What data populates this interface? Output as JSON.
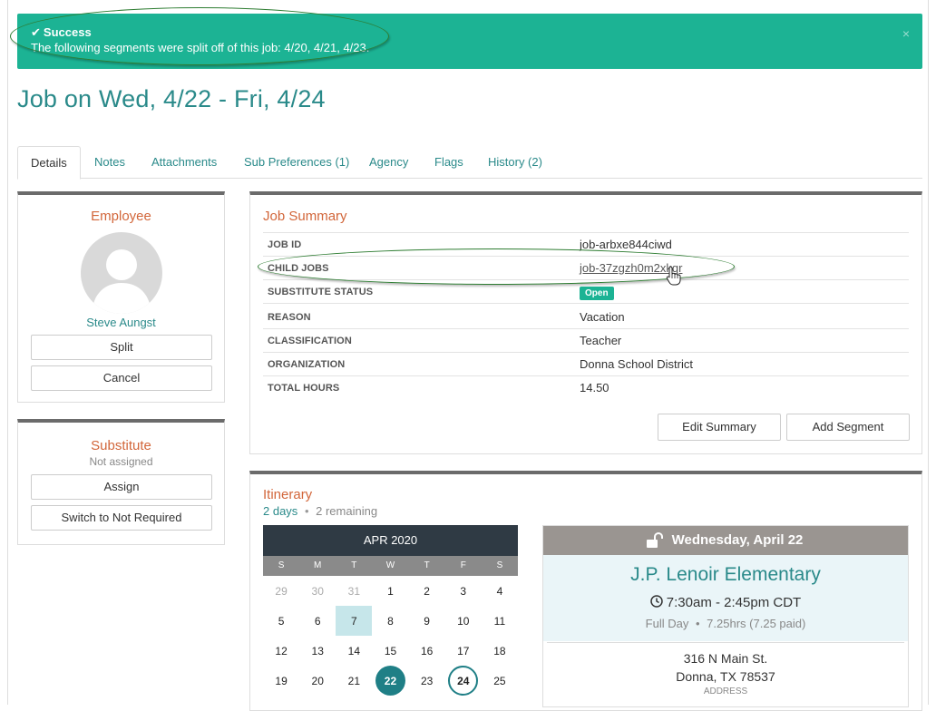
{
  "alert": {
    "title": "Success",
    "message": "The following segments were split off of this job: 4/20, 4/21, 4/23.",
    "close": "×",
    "color": "#1cb394"
  },
  "page": {
    "title": "Job on Wed, 4/22 - Fri, 4/24"
  },
  "tabs": [
    {
      "label": "Details"
    },
    {
      "label": "Notes"
    },
    {
      "label": "Attachments"
    },
    {
      "label": "Sub Preferences (1)"
    },
    {
      "label": "Agency"
    },
    {
      "label": "Flags"
    },
    {
      "label": "History (2)"
    }
  ],
  "employee": {
    "heading": "Employee",
    "name": "Steve Aungst",
    "split_label": "Split",
    "cancel_label": "Cancel"
  },
  "substitute": {
    "heading": "Substitute",
    "status": "Not assigned",
    "assign_label": "Assign",
    "switch_label": "Switch to Not Required"
  },
  "job_summary": {
    "heading": "Job Summary",
    "job_id_key": "JOB ID",
    "job_id": "job-arbxe844ciwd",
    "child_jobs_key": "CHILD JOBS",
    "child_jobs": "job-37zgzh0m2xkqr",
    "sub_status_key": "SUBSTITUTE STATUS",
    "sub_status": "Open",
    "reason_key": "REASON",
    "reason": "Vacation",
    "classification_key": "CLASSIFICATION",
    "classification": "Teacher",
    "organization_key": "ORGANIZATION",
    "organization": "Donna School District",
    "total_hours_key": "TOTAL HOURS",
    "total_hours": "14.50",
    "edit_label": "Edit Summary",
    "add_segment_label": "Add Segment"
  },
  "itinerary": {
    "heading": "Itinerary",
    "days": "2 days",
    "remaining": "2 remaining",
    "calendar": {
      "month": "APR 2020",
      "dow": [
        "S",
        "M",
        "T",
        "W",
        "T",
        "F",
        "S"
      ],
      "week1": [
        "29",
        "30",
        "31",
        "1",
        "2",
        "3",
        "4"
      ],
      "week2": [
        "5",
        "6",
        "7",
        "8",
        "9",
        "10",
        "11"
      ],
      "week3": [
        "12",
        "13",
        "14",
        "15",
        "16",
        "17",
        "18"
      ],
      "week4": [
        "19",
        "20",
        "21",
        "22",
        "23",
        "24",
        "25"
      ]
    },
    "day_card": {
      "date": "Wednesday, April 22",
      "school": "J.P. Lenoir Elementary",
      "time": "7:30am - 2:45pm CDT",
      "type": "Full Day",
      "hours": "7.25hrs",
      "paid": "(7.25 paid)",
      "address_line1": "316 N Main St.",
      "address_line2": "Donna, TX 78537",
      "address_label": "ADDRESS"
    }
  }
}
